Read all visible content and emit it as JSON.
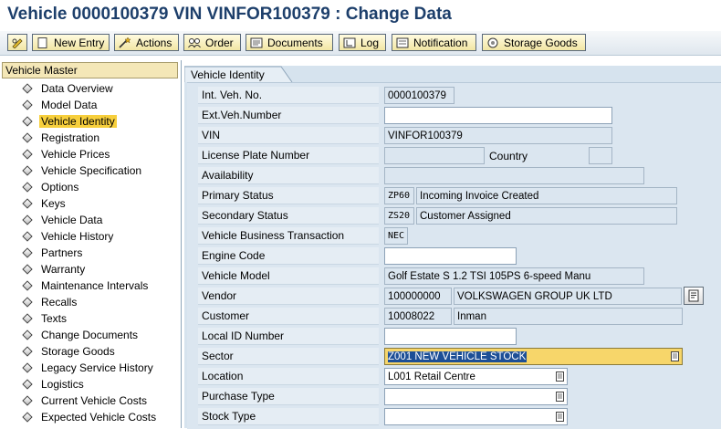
{
  "window": {
    "title": "Vehicle 0000100379 VIN VINFOR100379 : Change Data"
  },
  "toolbar": {
    "buttons": [
      {
        "label": "",
        "icon": "pencil-glasses-icon"
      },
      {
        "label": "New Entry",
        "icon": "new-document-icon"
      },
      {
        "label": "Actions",
        "icon": "magic-wand-icon"
      },
      {
        "label": "Order",
        "icon": "people-icon"
      },
      {
        "label": "Documents",
        "icon": "documents-icon"
      },
      {
        "label": "Log",
        "icon": "log-icon"
      },
      {
        "label": "Notification",
        "icon": "notification-icon"
      },
      {
        "label": "Storage Goods",
        "icon": "storage-goods-icon"
      }
    ]
  },
  "sidebar": {
    "header": "Vehicle Master",
    "items": [
      {
        "label": "Data Overview",
        "selected": false
      },
      {
        "label": "Model Data",
        "selected": false
      },
      {
        "label": "Vehicle Identity",
        "selected": true
      },
      {
        "label": "Registration",
        "selected": false
      },
      {
        "label": "Vehicle Prices",
        "selected": false
      },
      {
        "label": "Vehicle Specification",
        "selected": false
      },
      {
        "label": "Options",
        "selected": false
      },
      {
        "label": "Keys",
        "selected": false
      },
      {
        "label": "Vehicle Data",
        "selected": false
      },
      {
        "label": "Vehicle History",
        "selected": false
      },
      {
        "label": "Partners",
        "selected": false
      },
      {
        "label": "Warranty",
        "selected": false
      },
      {
        "label": "Maintenance Intervals",
        "selected": false
      },
      {
        "label": "Recalls",
        "selected": false
      },
      {
        "label": "Texts",
        "selected": false
      },
      {
        "label": "Change Documents",
        "selected": false
      },
      {
        "label": "Storage Goods",
        "selected": false
      },
      {
        "label": "Legacy Service History",
        "selected": false
      },
      {
        "label": "Logistics",
        "selected": false
      },
      {
        "label": "Current Vehicle Costs",
        "selected": false
      },
      {
        "label": "Expected Vehicle Costs",
        "selected": false
      }
    ]
  },
  "main": {
    "tab_label": "Vehicle Identity",
    "fields": {
      "int_veh_no": {
        "label": "Int. Veh. No.",
        "value": "0000100379"
      },
      "ext_veh_number": {
        "label": "Ext.Veh.Number",
        "value": ""
      },
      "vin": {
        "label": "VIN",
        "value": "VINFOR100379"
      },
      "license_plate": {
        "label": "License Plate Number",
        "value": "",
        "country_label": "Country",
        "country_value": ""
      },
      "availability": {
        "label": "Availability",
        "value": ""
      },
      "primary_status": {
        "label": "Primary Status",
        "code": "ZP60",
        "text": "Incoming Invoice Created"
      },
      "secondary_status": {
        "label": "Secondary Status",
        "code": "ZS20",
        "text": "Customer Assigned"
      },
      "business_transaction": {
        "label": "Vehicle Business Transaction",
        "code": "NEC"
      },
      "engine_code": {
        "label": "Engine Code",
        "value": ""
      },
      "vehicle_model": {
        "label": "Vehicle Model",
        "value": "Golf Estate S 1.2 TSI 105PS 6-speed Manu"
      },
      "vendor": {
        "label": "Vendor",
        "code": "100000000",
        "text": "VOLKSWAGEN GROUP UK LTD"
      },
      "customer": {
        "label": "Customer",
        "code": "10008022",
        "text": "Inman"
      },
      "local_id": {
        "label": "Local ID Number",
        "value": ""
      },
      "sector": {
        "label": "Sector",
        "value": "Z001 NEW VEHICLE STOCK"
      },
      "location": {
        "label": "Location",
        "value": "L001 Retail Centre"
      },
      "purchase_type": {
        "label": "Purchase Type",
        "value": ""
      },
      "stock_type": {
        "label": "Stock Type",
        "value": ""
      }
    }
  },
  "colors": {
    "title_text": "#1d3f6b",
    "panel_bg": "#dbe6f0",
    "selected_nav": "#f7cf3c",
    "sector_highlight": "#f7d66a",
    "text_selection": "#1d4f96"
  }
}
